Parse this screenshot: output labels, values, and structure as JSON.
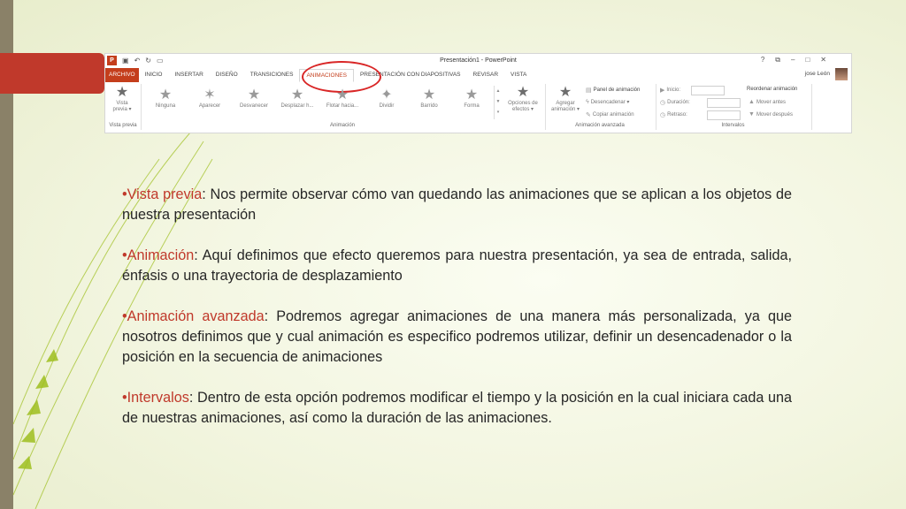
{
  "ribbon": {
    "window_title": "Presentación1 - PowerPoint",
    "app_logo": "P",
    "qa_icons": [
      "save-icon",
      "undo-icon",
      "redo-icon",
      "present-icon"
    ],
    "win_controls": [
      "?",
      "⧉",
      "–",
      "□",
      "✕"
    ],
    "user_name": "jose León",
    "tabs": [
      {
        "label": "ARCHIVO",
        "kind": "file"
      },
      {
        "label": "INICIO"
      },
      {
        "label": "INSERTAR"
      },
      {
        "label": "DISEÑO"
      },
      {
        "label": "TRANSICIONES"
      },
      {
        "label": "ANIMACIONES",
        "kind": "active"
      },
      {
        "label": "PRESENTACIÓN CON DIAPOSITIVAS"
      },
      {
        "label": "REVISAR"
      },
      {
        "label": "VISTA"
      }
    ],
    "preview": {
      "label_line1": "Vista",
      "label_line2": "previa ▾",
      "group": "Vista previa"
    },
    "animations": [
      "Ninguna",
      "Aparecer",
      "Desvanecer",
      "Desplazar h...",
      "Flotar hacia...",
      "Dividir",
      "Barrido",
      "Forma"
    ],
    "effect_options": {
      "line1": "Opciones de",
      "line2": "efectos ▾"
    },
    "animation_group": "Animación",
    "add_animation": {
      "line1": "Agregar",
      "line2": "animación ▾"
    },
    "advanced": {
      "panel": "Panel de animación",
      "trigger": "Desencadenar ▾",
      "copy": "Copiar animación",
      "group": "Animación avanzada"
    },
    "timing": {
      "start": "Inicio:",
      "duration": "Duración:",
      "delay": "Retraso:",
      "reorder": "Reordenar animación",
      "move_earlier": "Mover antes",
      "move_later": "Mover después",
      "group": "Intervalos"
    }
  },
  "bullets": [
    {
      "term": "•Vista previa",
      "text": ": Nos permite observar cómo van quedando las animaciones que se aplican a los objetos de nuestra presentación"
    },
    {
      "term": "•Animación",
      "text": ": Aquí definimos que efecto queremos para nuestra presentación, ya sea de entrada, salida, énfasis o una trayectoria de desplazamiento"
    },
    {
      "term": "•Animación avanzada",
      "text": ": Podremos agregar animaciones de una manera más personalizada, ya que nosotros definimos que y cual animación es especifico podremos utilizar, definir un desencadenador o la posición en la secuencia de animaciones"
    },
    {
      "term": "•Intervalos",
      "text": ": Dentro de esta opción podremos modificar el tiempo y la posición en la cual iniciara cada una de nuestras animaciones, así como la duración de las animaciones."
    }
  ],
  "colors": {
    "accent": "#c0392b",
    "circle": "#d92626",
    "file_tab": "#c43e1c"
  }
}
